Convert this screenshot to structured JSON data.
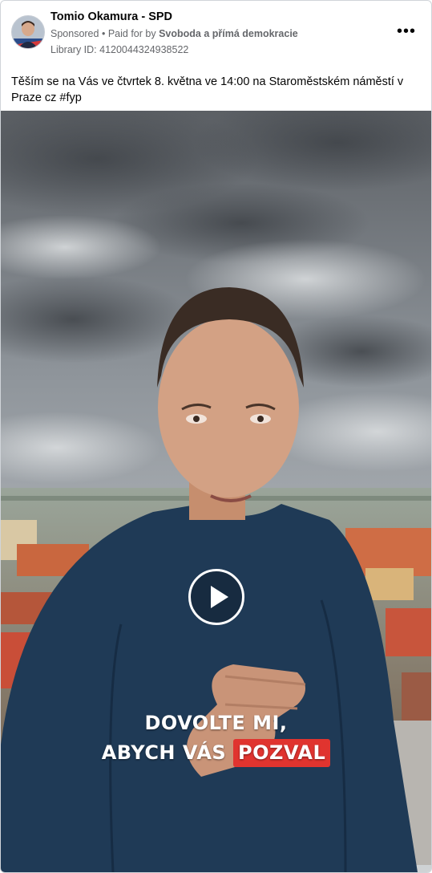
{
  "post": {
    "page_name": "Tomio Okamura - SPD",
    "sponsored": "Sponsored",
    "paid_prefix": "Paid for by",
    "paid_by": "Svoboda a přímá demokracie",
    "library_id": "Library ID: 4120044324938522",
    "more_icon": "more-horizontal-icon",
    "caption": "Těším se na Vás ve čtvrtek 8. května ve 14:00 na Staroměstském náměstí v Praze cz #fyp"
  },
  "video": {
    "overlay_line1": "DOVOLTE MI,",
    "overlay_line2_prefix": "ABYCH VÁS",
    "overlay_line2_highlight": "POZVAL",
    "highlight_color": "#e0342f",
    "play_icon": "play-icon"
  }
}
